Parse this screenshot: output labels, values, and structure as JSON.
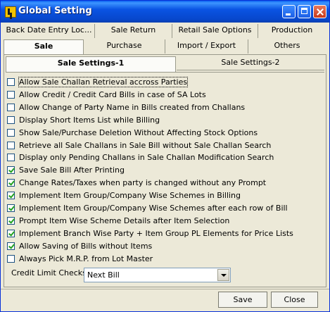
{
  "window": {
    "title": "Global Setting"
  },
  "tabs_row1": [
    "Back Date Entry Loc...",
    "Sale Return",
    "Retail Sale Options",
    "Production"
  ],
  "tabs_row2": [
    "Sale",
    "Purchase",
    "Import / Export",
    "Others"
  ],
  "subtabs": [
    "Sale Settings-1",
    "Sale Settings-2"
  ],
  "options": [
    {
      "label": "Allow Sale Challan Retrieval accross Parties",
      "checked": false
    },
    {
      "label": "Allow Credit / Credit Card Bills in case of SA Lots",
      "checked": false
    },
    {
      "label": "Allow Change of Party Name in Bills created from Challans",
      "checked": false
    },
    {
      "label": "Display Short Items List while Billing",
      "checked": false
    },
    {
      "label": "Show Sale/Purchase Deletion Without Affecting Stock Options",
      "checked": false
    },
    {
      "label": "Retrieve all Sale Challans in Sale Bill without Sale Challan Search",
      "checked": false
    },
    {
      "label": "Display only Pending Challans in Sale Challan Modification Search",
      "checked": false
    },
    {
      "label": "Save Sale Bill After Printing",
      "checked": true
    },
    {
      "label": "Change Rates/Taxes when party is changed without any Prompt",
      "checked": true
    },
    {
      "label": "Implement Item Group/Company Wise Schemes in Billing",
      "checked": true
    },
    {
      "label": "Implement Item Group/Company Wise Schemes after each row of Bill",
      "checked": true
    },
    {
      "label": "Prompt Item Wise Scheme Details after Item Selection",
      "checked": true
    },
    {
      "label": "Implement Branch Wise Party + Item Group PL Elements for Price Lists",
      "checked": true
    },
    {
      "label": "Allow Saving of Bills without Items",
      "checked": true
    },
    {
      "label": "Always Pick M.R.P. from Lot Master",
      "checked": false
    }
  ],
  "credit_limit": {
    "label": "Credit Limit Checks",
    "value": "Next Bill"
  },
  "buttons": {
    "save": "Save",
    "close": "Close"
  }
}
